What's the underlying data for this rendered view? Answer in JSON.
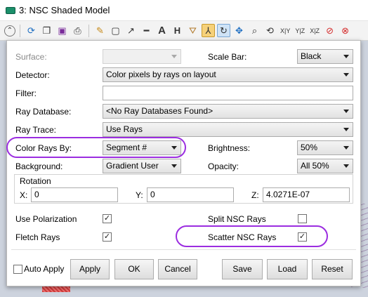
{
  "window": {
    "title": "3: NSC Shaded Model"
  },
  "toolbar": {
    "icons": [
      "settings-collapse-icon",
      "refresh-icon",
      "copy-icon",
      "save-icon",
      "print-icon",
      "pencil-icon",
      "rectangle-icon",
      "arrow-icon",
      "line-icon",
      "text-icon",
      "dimension-icon",
      "view-perspective-icon",
      "axes-icon",
      "rotate-icon",
      "pan-icon",
      "zoom-icon",
      "reset-view-icon",
      "xy-view",
      "yz-view",
      "xz-view",
      "stop-icon",
      "close-icon"
    ],
    "xy": "X|Y",
    "yz": "Y|Z",
    "xz": "X|Z"
  },
  "form": {
    "surface": {
      "label": "Surface:",
      "value": ""
    },
    "scale_bar": {
      "label": "Scale Bar:",
      "value": "Black"
    },
    "detector": {
      "label": "Detector:",
      "value": "Color pixels by rays on layout"
    },
    "filter": {
      "label": "Filter:",
      "value": ""
    },
    "ray_database": {
      "label": "Ray Database:",
      "value": "<No Ray Databases Found>"
    },
    "ray_trace": {
      "label": "Ray Trace:",
      "value": "Use Rays"
    },
    "color_rays_by": {
      "label": "Color Rays By:",
      "value": "Segment #"
    },
    "brightness": {
      "label": "Brightness:",
      "value": "50%"
    },
    "background": {
      "label": "Background:",
      "value": "Gradient User"
    },
    "opacity": {
      "label": "Opacity:",
      "value": "All 50%"
    },
    "rotation": {
      "title": "Rotation",
      "x_label": "X:",
      "x": "0",
      "y_label": "Y:",
      "y": "0",
      "z_label": "Z:",
      "z": "4.0271E-07"
    },
    "use_polarization": {
      "label": "Use Polarization",
      "checked": true
    },
    "split_nsc_rays": {
      "label": "Split NSC Rays",
      "checked": false
    },
    "fletch_rays": {
      "label": "Fletch Rays",
      "checked": true
    },
    "scatter_nsc_rays": {
      "label": "Scatter NSC Rays",
      "checked": true
    }
  },
  "buttons": {
    "auto_apply": "Auto Apply",
    "apply": "Apply",
    "ok": "OK",
    "cancel": "Cancel",
    "save": "Save",
    "load": "Load",
    "reset": "Reset"
  },
  "colors": {
    "highlight": "#9b2de0",
    "accent_active": "#f6d17a",
    "app_icon": "#1b8f6a"
  }
}
